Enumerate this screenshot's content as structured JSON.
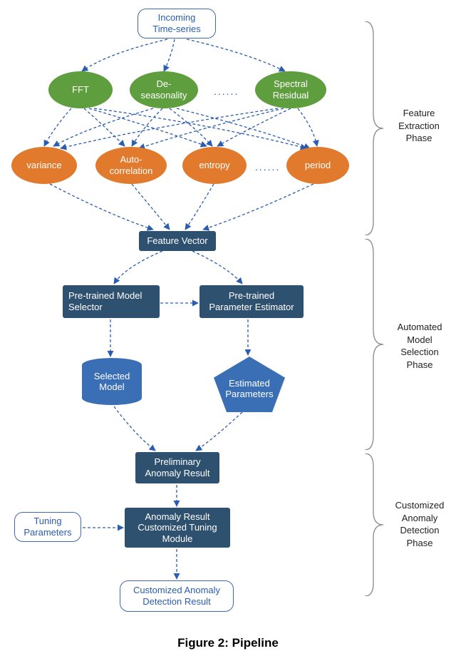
{
  "nodes": {
    "incoming": "Incoming\nTime-series",
    "fft": "FFT",
    "deseason": "De-\nseasonality",
    "spectral": "Spectral\nResidual",
    "variance": "variance",
    "autocorr": "Auto-\ncorrelation",
    "entropy": "entropy",
    "period": "period",
    "feature_vector": "Feature Vector",
    "model_selector": "Pre-trained Model\nSelector",
    "param_estimator": "Pre-trained\nParameter Estimator",
    "selected_model": "Selected\nModel",
    "estimated_params": "Estimated\nParameters",
    "prelim_result": "Preliminary\nAnomaly Result",
    "tuning_params": "Tuning\nParameters",
    "tuning_module": "Anomaly Result\nCustomized Tuning\nModule",
    "final_result": "Customized Anomaly\nDetection Result"
  },
  "ellipsis": "......",
  "phases": {
    "p1": "Feature\nExtraction\nPhase",
    "p2": "Automated\nModel\nSelection\nPhase",
    "p3": "Customized\nAnomaly\nDetection\nPhase"
  },
  "caption": "Figure 2: Pipeline",
  "colors": {
    "arrow": "#2a5db0",
    "brace": "#888"
  }
}
